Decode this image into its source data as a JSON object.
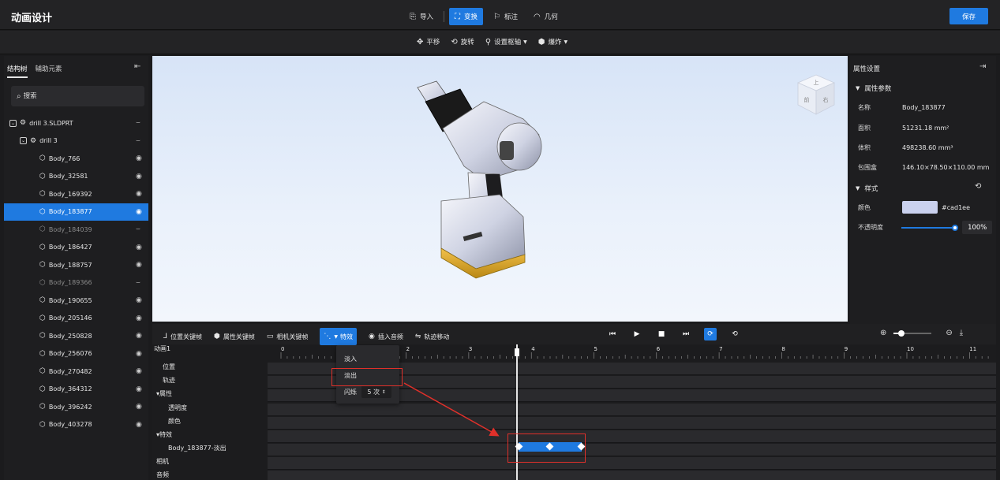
{
  "header": {
    "title": "动画设计",
    "tabs": [
      {
        "label": "导入",
        "icon": "import-icon"
      },
      {
        "label": "变换",
        "icon": "transform-icon"
      },
      {
        "label": "标注",
        "icon": "annotation-icon"
      },
      {
        "label": "几何",
        "icon": "geometry-icon"
      }
    ],
    "active_tab": "变换",
    "save_label": "保存"
  },
  "subtoolbar": {
    "tools": [
      {
        "label": "平移",
        "icon": "move-icon"
      },
      {
        "label": "旋转",
        "icon": "rotate-icon"
      },
      {
        "label": "设置枢轴",
        "icon": "pivot-icon",
        "dropdown": true
      },
      {
        "label": "爆炸",
        "icon": "explode-icon",
        "dropdown": true
      }
    ]
  },
  "left_panel": {
    "tabs": [
      "结构树",
      "辅助元素"
    ],
    "search_placeholder": "搜索",
    "tree": [
      {
        "label": "drill 3.SLDPRT",
        "level": 0,
        "type": "assembly",
        "visible": false
      },
      {
        "label": "drill 3",
        "level": 1,
        "type": "assembly",
        "visible": false
      },
      {
        "label": "Body_766",
        "level": 2,
        "visible": true
      },
      {
        "label": "Body_32581",
        "level": 2,
        "visible": true
      },
      {
        "label": "Body_169392",
        "level": 2,
        "visible": true
      },
      {
        "label": "Body_183877",
        "level": 2,
        "visible": true,
        "selected": true
      },
      {
        "label": "Body_184039",
        "level": 2,
        "visible": false,
        "dim": true
      },
      {
        "label": "Body_186427",
        "level": 2,
        "visible": true
      },
      {
        "label": "Body_188757",
        "level": 2,
        "visible": true
      },
      {
        "label": "Body_189366",
        "level": 2,
        "visible": false,
        "dim": true
      },
      {
        "label": "Body_190655",
        "level": 2,
        "visible": true
      },
      {
        "label": "Body_205146",
        "level": 2,
        "visible": true
      },
      {
        "label": "Body_250828",
        "level": 2,
        "visible": true
      },
      {
        "label": "Body_256076",
        "level": 2,
        "visible": true
      },
      {
        "label": "Body_270482",
        "level": 2,
        "visible": true
      },
      {
        "label": "Body_364312",
        "level": 2,
        "visible": true
      },
      {
        "label": "Body_396242",
        "level": 2,
        "visible": true
      },
      {
        "label": "Body_403278",
        "level": 2,
        "visible": true
      }
    ]
  },
  "viewcube": {
    "top": "上",
    "front": "前",
    "right": "右"
  },
  "right_panel": {
    "title": "属性设置",
    "section_params": "属性参数",
    "props": [
      {
        "key": "名称",
        "value": "Body_183877"
      },
      {
        "key": "面积",
        "value": "51231.18 mm²"
      },
      {
        "key": "体积",
        "value": "498238.60 mm³"
      },
      {
        "key": "包围盒",
        "value": "146.10×78.50×110.00 mm"
      }
    ],
    "section_style": "样式",
    "color_label": "颜色",
    "color_value": "#cad1ee",
    "opacity_label": "不透明度",
    "opacity_value": "100%",
    "opacity_fraction": 1.0
  },
  "timeline": {
    "tools": [
      {
        "label": "位置关键帧",
        "icon": "position-keyframe-icon"
      },
      {
        "label": "属性关键帧",
        "icon": "property-keyframe-icon"
      },
      {
        "label": "相机关键帧",
        "icon": "camera-keyframe-icon"
      },
      {
        "label": "特效",
        "icon": "effects-icon",
        "dropdown": true,
        "active": true
      },
      {
        "label": "插入音频",
        "icon": "audio-icon"
      },
      {
        "label": "轨迹移动",
        "icon": "track-move-icon"
      }
    ],
    "animation_name": "动画1",
    "rows": [
      {
        "label": "位置",
        "indent": 1
      },
      {
        "label": "轨迹",
        "indent": 1
      },
      {
        "label": "▾属性",
        "indent": 0
      },
      {
        "label": "透明度",
        "indent": 2
      },
      {
        "label": "颜色",
        "indent": 2
      },
      {
        "label": "▾特效",
        "indent": 0
      },
      {
        "label": "Body_183877-淡出",
        "indent": 2
      },
      {
        "label": "相机",
        "indent": 0
      },
      {
        "label": "音频",
        "indent": 0
      }
    ],
    "ruler_labels": [
      "0",
      "1",
      "2",
      "3",
      "4",
      "5",
      "6",
      "7",
      "8",
      "9",
      "10",
      "11"
    ],
    "playhead_time": 3.8,
    "clip": {
      "start": 3.8,
      "end": 4.8,
      "keyframes": [
        3.8,
        4.3,
        4.8
      ]
    },
    "effect_menu": {
      "items": [
        "淡入",
        "淡出"
      ],
      "blink_label": "闪烁",
      "blink_count": "5",
      "blink_unit": "次"
    }
  }
}
